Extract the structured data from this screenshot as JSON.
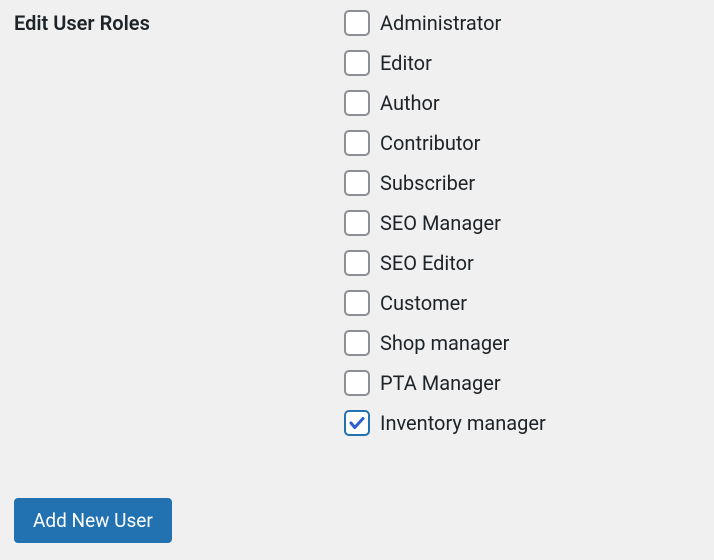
{
  "section": {
    "title": "Edit User Roles"
  },
  "roles": [
    {
      "label": "Administrator",
      "checked": false
    },
    {
      "label": "Editor",
      "checked": false
    },
    {
      "label": "Author",
      "checked": false
    },
    {
      "label": "Contributor",
      "checked": false
    },
    {
      "label": "Subscriber",
      "checked": false
    },
    {
      "label": "SEO Manager",
      "checked": false
    },
    {
      "label": "SEO Editor",
      "checked": false
    },
    {
      "label": "Customer",
      "checked": false
    },
    {
      "label": "Shop manager",
      "checked": false
    },
    {
      "label": "PTA Manager",
      "checked": false
    },
    {
      "label": "Inventory manager",
      "checked": true
    }
  ],
  "submit": {
    "label": "Add New User"
  }
}
